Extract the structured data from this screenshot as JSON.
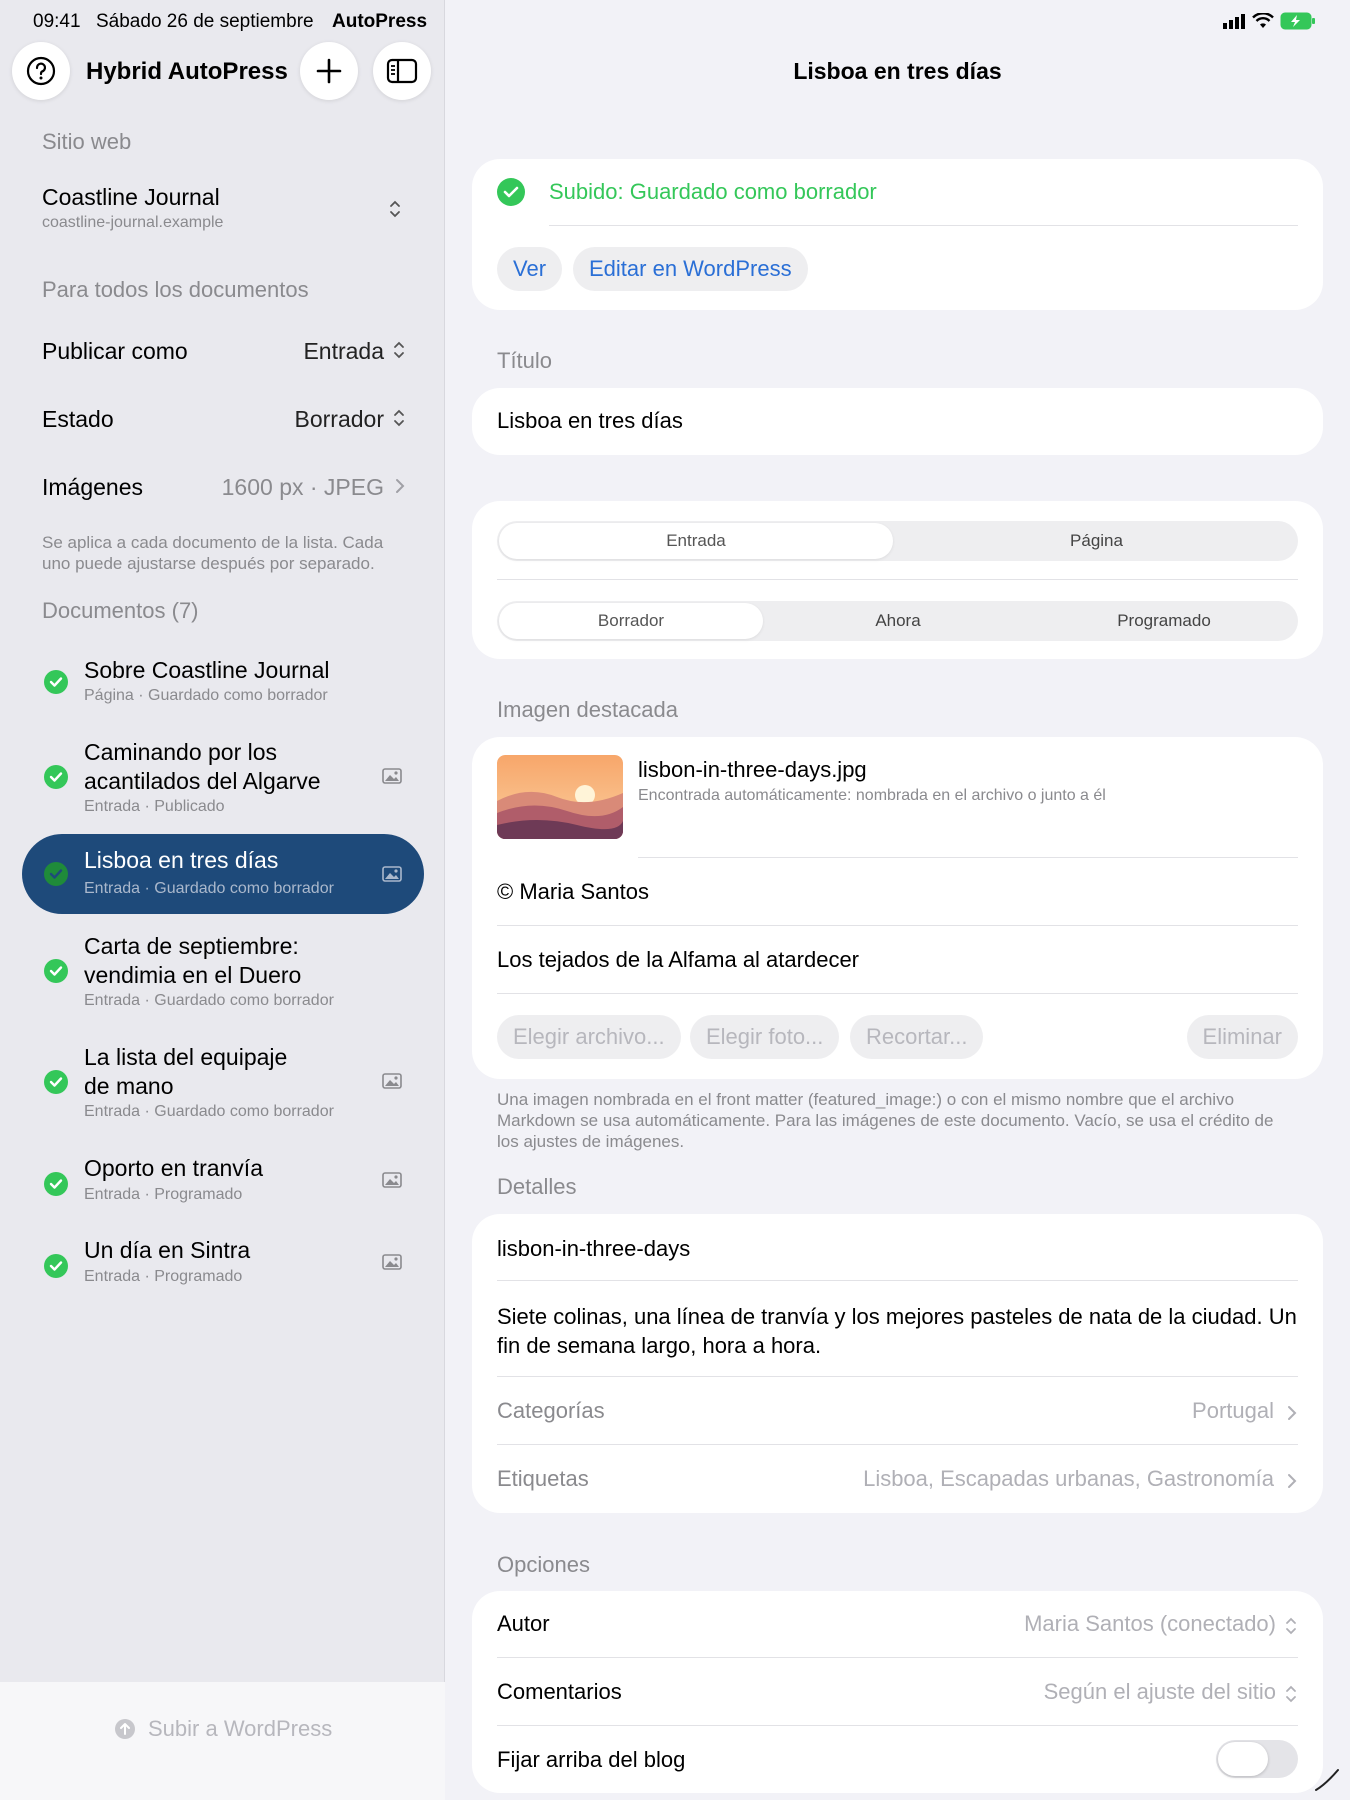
{
  "status": {
    "time": "09:41",
    "date": "Sábado 26 de septiembre",
    "app": "AutoPress"
  },
  "sidebar": {
    "app_title": "Hybrid AutoPress",
    "site_section": "Sitio web",
    "site_name": "Coastline Journal",
    "site_url": "coastline-journal.example",
    "all_docs_section": "Para todos los documentos",
    "publish_as": {
      "label": "Publicar como",
      "value": "Entrada"
    },
    "status": {
      "label": "Estado",
      "value": "Borrador"
    },
    "images": {
      "label": "Imágenes",
      "value": "1600 px · JPEG"
    },
    "note": "Se aplica a cada documento de la lista. Cada uno puede ajustarse después por separado.",
    "docs_section": "Documentos (7)",
    "documents": [
      {
        "title": "Sobre Coastline Journal",
        "subtitle": "Página · Guardado como borrador",
        "has_image": false
      },
      {
        "title": "Caminando por los acantilados del Algarve",
        "subtitle": "Entrada · Publicado",
        "has_image": true
      },
      {
        "title": "Lisboa en tres días",
        "subtitle": "Entrada · Guardado como borrador",
        "has_image": true,
        "selected": true
      },
      {
        "title": "Carta de septiembre: vendimia en el Duero",
        "subtitle": "Entrada · Guardado como borrador",
        "has_image": false
      },
      {
        "title": "La lista del equipaje de mano",
        "subtitle": "Entrada · Guardado como borrador",
        "has_image": true
      },
      {
        "title": "Oporto en tranvía",
        "subtitle": "Entrada · Programado",
        "has_image": true
      },
      {
        "title": "Un día en Sintra",
        "subtitle": "Entrada · Programado",
        "has_image": true
      }
    ],
    "upload_label": "Subir a WordPress"
  },
  "main": {
    "title": "Lisboa en tres días",
    "upload_status": "Subido: Guardado como borrador",
    "view_button": "Ver",
    "edit_button": "Editar en WordPress",
    "title_section": "Título",
    "title_value": "Lisboa en tres días",
    "type_options": [
      "Entrada",
      "Página"
    ],
    "type_selected": "Entrada",
    "status_options": [
      "Borrador",
      "Ahora",
      "Programado"
    ],
    "status_selected": "Borrador",
    "featured_section": "Imagen destacada",
    "image_filename": "lisbon-in-three-days.jpg",
    "image_note": "Encontrada automáticamente: nombrada en el archivo o junto a él",
    "credit": "© Maria Santos",
    "caption": "Los tejados de la Alfama al atardecer",
    "image_buttons": {
      "choose_file": "Elegir archivo...",
      "choose_photo": "Elegir foto...",
      "crop": "Recortar...",
      "remove": "Eliminar"
    },
    "image_info": "Una imagen nombrada en el front matter (featured_image:) o con el mismo nombre que el archivo Markdown se usa automáticamente. Para las imágenes de este documento. Vacío, se usa el crédito de los ajustes de imágenes.",
    "details_section": "Detalles",
    "slug": "lisbon-in-three-days",
    "excerpt": "Siete colinas, una línea de tranvía y los mejores pasteles de nata de la ciudad. Un fin de semana largo, hora a hora.",
    "categories": {
      "label": "Categorías",
      "value": "Portugal"
    },
    "tags": {
      "label": "Etiquetas",
      "value": "Lisboa, Escapadas urbanas, Gastronomía"
    },
    "options_section": "Opciones",
    "author": {
      "label": "Autor",
      "value": "Maria Santos (conectado)"
    },
    "comments": {
      "label": "Comentarios",
      "value": "Según el ajuste del sitio"
    },
    "sticky": {
      "label": "Fijar arriba del blog",
      "on": false
    }
  },
  "colors": {
    "accent": "#2a6fd6",
    "success": "#34c759",
    "selected_doc": "#1e4a7a"
  }
}
